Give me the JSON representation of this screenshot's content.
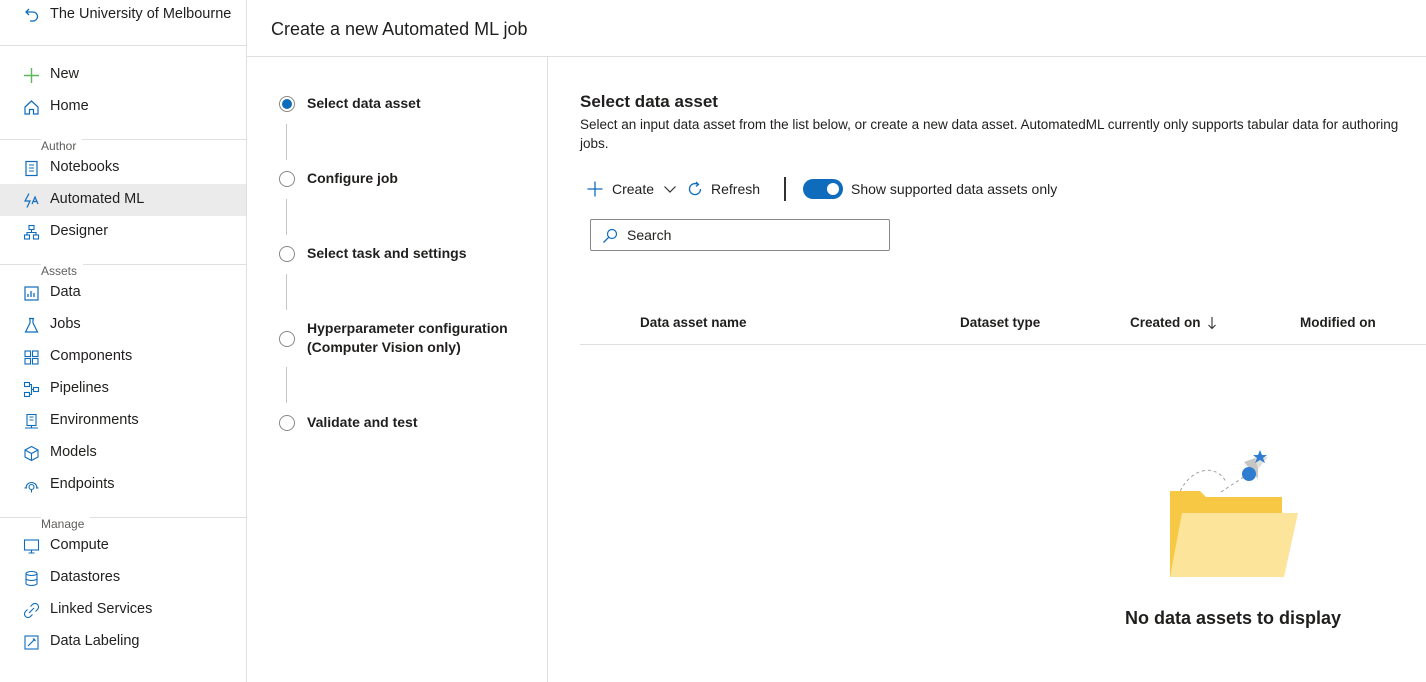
{
  "sidebar": {
    "workspace": "The University of Melbourne",
    "items_top": [
      {
        "label": "New",
        "icon": "plus-icon"
      },
      {
        "label": "Home",
        "icon": "home-icon"
      }
    ],
    "sections": [
      {
        "label": "Author",
        "items": [
          {
            "label": "Notebooks",
            "icon": "notebook-icon"
          },
          {
            "label": "Automated ML",
            "icon": "automated-ml-icon",
            "active": true
          },
          {
            "label": "Designer",
            "icon": "designer-icon"
          }
        ]
      },
      {
        "label": "Assets",
        "items": [
          {
            "label": "Data",
            "icon": "data-icon"
          },
          {
            "label": "Jobs",
            "icon": "flask-icon"
          },
          {
            "label": "Components",
            "icon": "components-icon"
          },
          {
            "label": "Pipelines",
            "icon": "pipelines-icon"
          },
          {
            "label": "Environments",
            "icon": "environments-icon"
          },
          {
            "label": "Models",
            "icon": "cube-icon"
          },
          {
            "label": "Endpoints",
            "icon": "endpoint-icon"
          }
        ]
      },
      {
        "label": "Manage",
        "items": [
          {
            "label": "Compute",
            "icon": "monitor-icon"
          },
          {
            "label": "Datastores",
            "icon": "database-icon"
          },
          {
            "label": "Linked Services",
            "icon": "linked-services-icon"
          },
          {
            "label": "Data Labeling",
            "icon": "labeling-icon"
          }
        ]
      }
    ]
  },
  "header": {
    "title": "Create a new Automated ML job"
  },
  "steps": [
    {
      "label": "Select data asset",
      "current": true
    },
    {
      "label": "Configure job",
      "current": false
    },
    {
      "label": "Select task and settings",
      "current": false
    },
    {
      "label": "Hyperparameter configuration (Computer Vision only)",
      "current": false
    },
    {
      "label": "Validate and test",
      "current": false
    }
  ],
  "main": {
    "title": "Select data asset",
    "description": "Select an input data asset from the list below, or create a new data asset. AutomatedML currently only supports tabular data for authoring jobs.",
    "toolbar": {
      "create_label": "Create",
      "refresh_label": "Refresh",
      "toggle_label": "Show supported data assets only",
      "toggle_on": true
    },
    "search": {
      "placeholder": "Search",
      "value": ""
    },
    "columns": [
      "Data asset name",
      "Dataset type",
      "Created on",
      "Modified on"
    ],
    "sorted_column": "Created on",
    "sort_direction": "descending",
    "empty_message": "No data assets to display"
  },
  "colors": {
    "accent": "#0f6cbd",
    "active_nav_bg": "#ebebeb",
    "border": "#e1dfdd",
    "plus_green": "#5db75a"
  }
}
